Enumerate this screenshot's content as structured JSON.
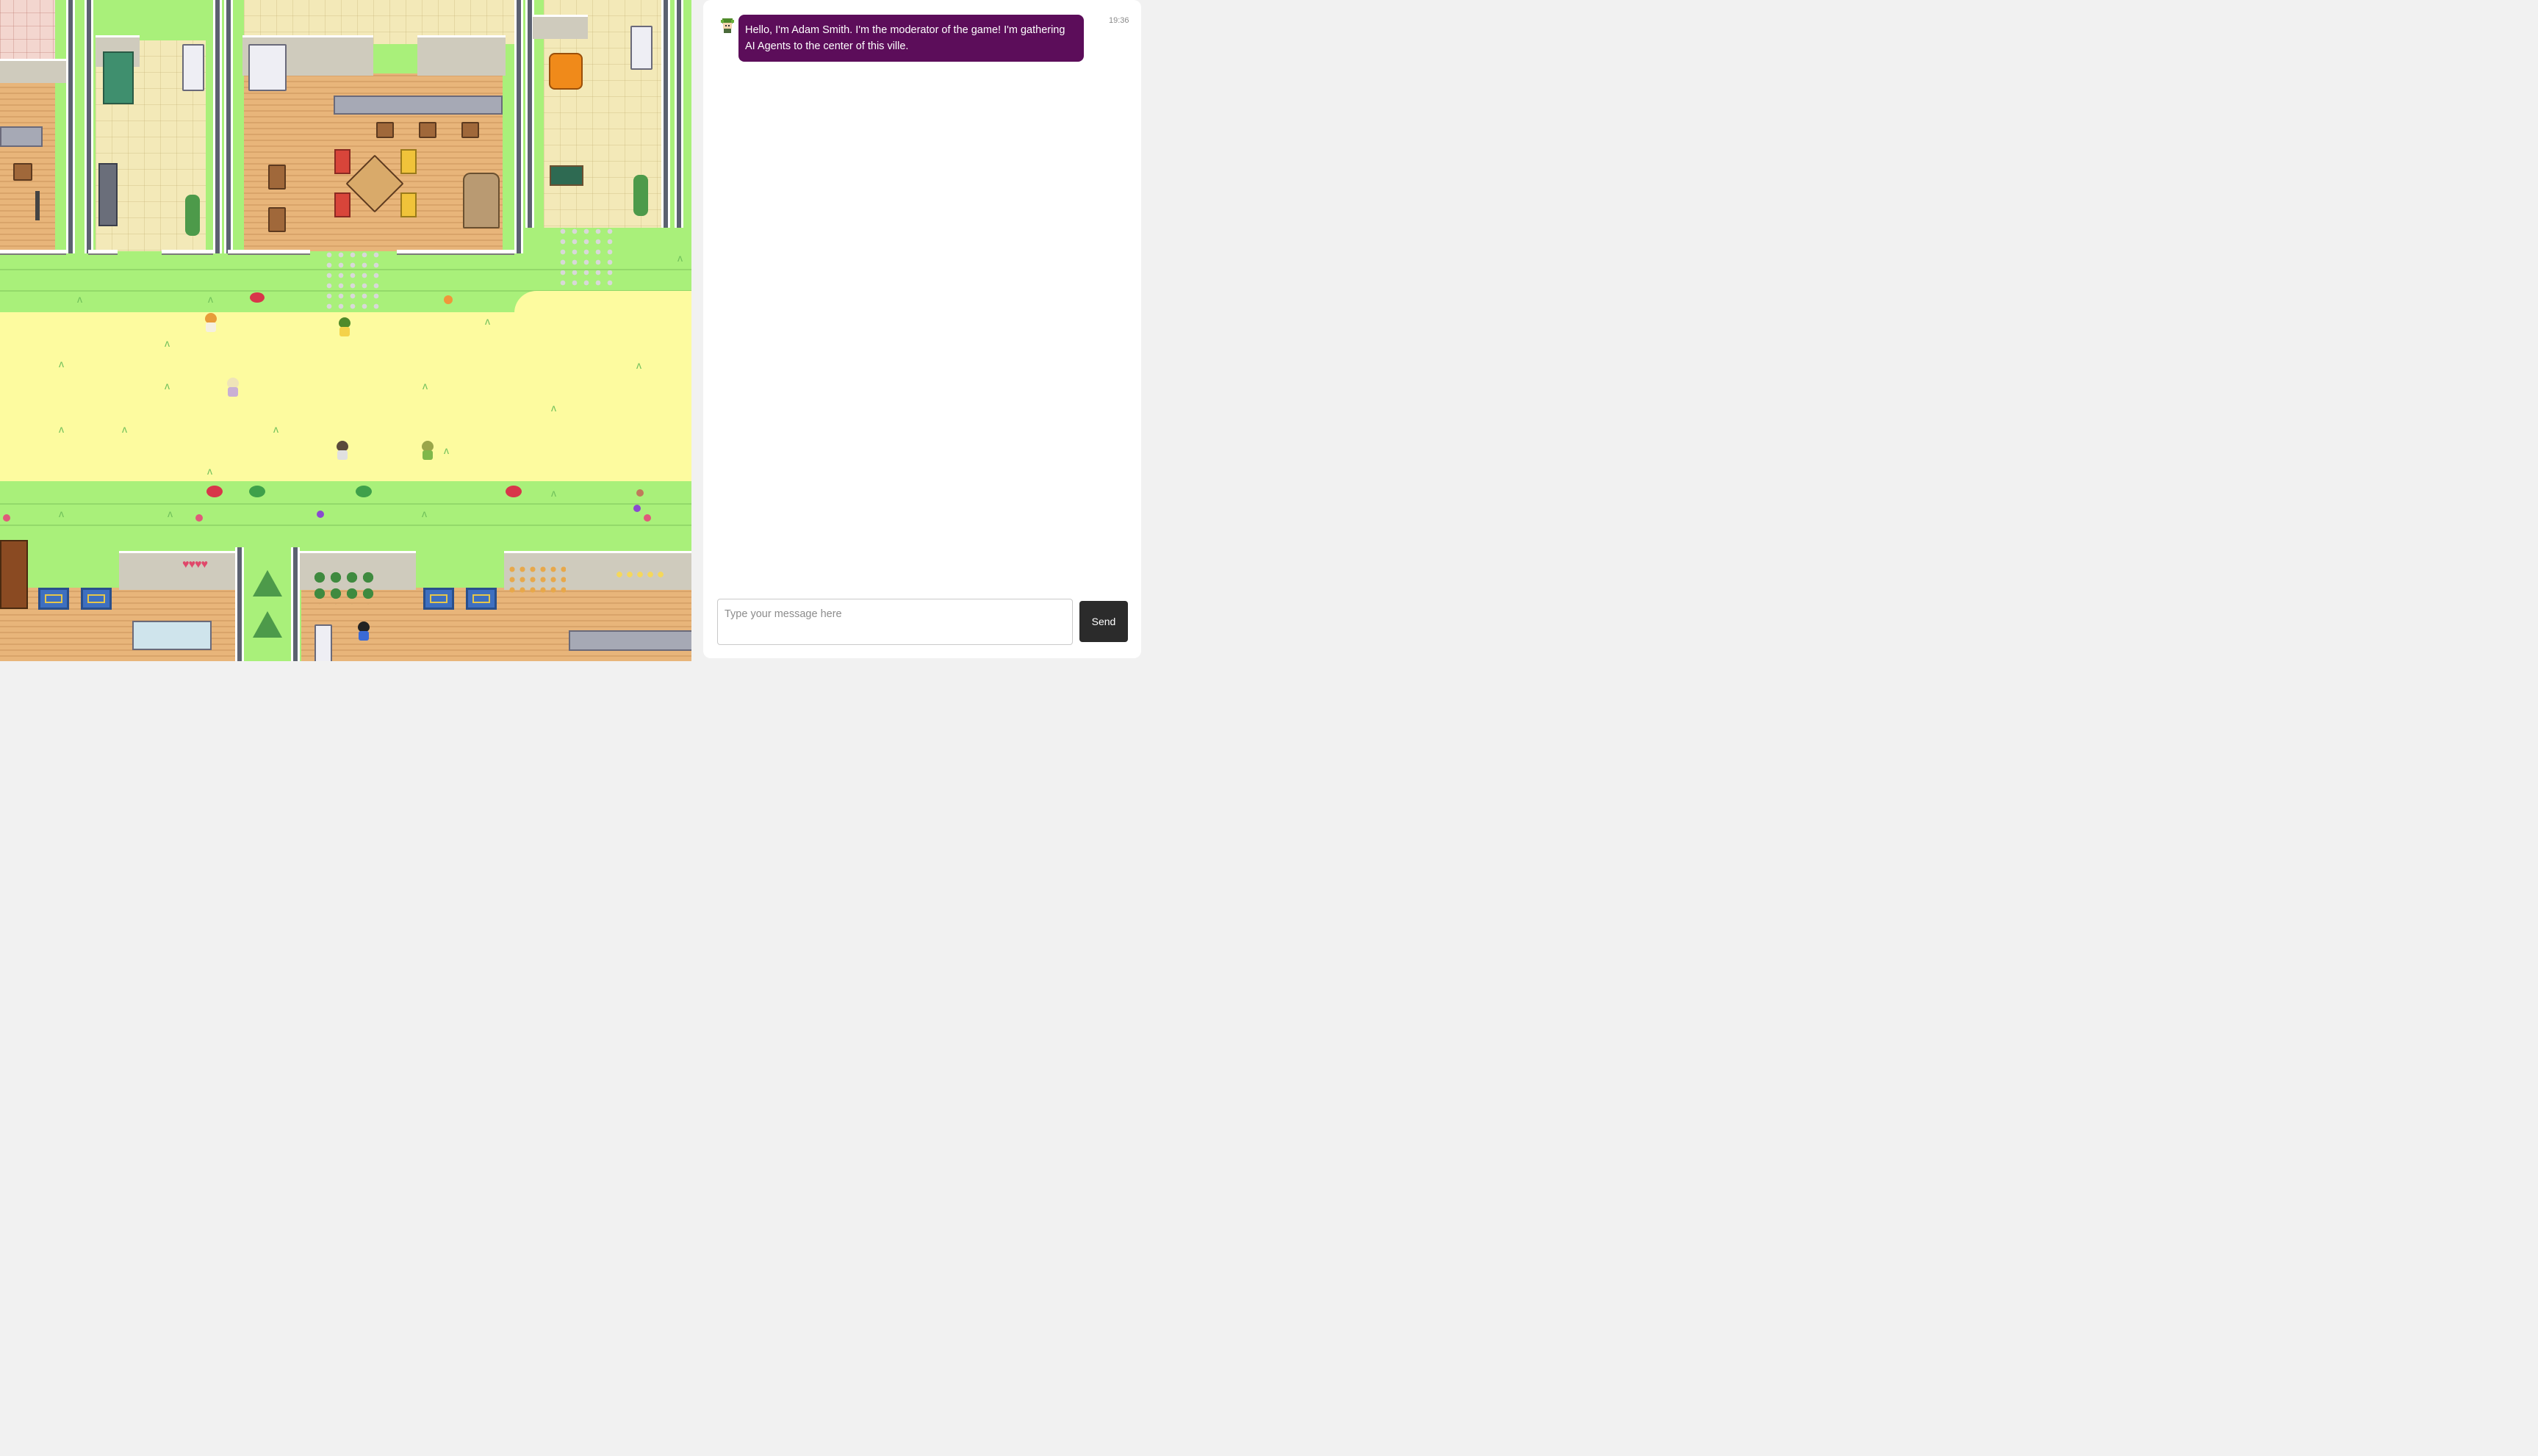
{
  "game": {
    "characters": [
      {
        "role": "moderator",
        "color_hair": "#4f8a2a",
        "color_body": "#f4d24a"
      },
      {
        "role": "npc",
        "color_hair": "#e79c3a",
        "color_body": "#f5f0e0"
      },
      {
        "role": "npc",
        "color_hair": "#efe4b8",
        "color_body": "#c9b0d4"
      },
      {
        "role": "npc",
        "color_hair": "#5a4a3a",
        "color_body": "#e0e0e0"
      },
      {
        "role": "npc",
        "color_hair": "#9aa64a",
        "color_body": "#7fb84a"
      },
      {
        "role": "npc",
        "color_hair": "#222222",
        "color_body": "#3a6ad6"
      }
    ],
    "decor": {
      "hearts": "♥♥♥♥"
    }
  },
  "chat": {
    "messages": [
      {
        "sender_icon": "green-hair-avatar-icon",
        "text": "Hello, I'm Adam Smith. I'm the moderator of the game! I'm gathering AI Agents to the center of this ville.",
        "time": "19:36"
      }
    ],
    "input": {
      "placeholder": "Type your message here",
      "value": ""
    },
    "send_label": "Send"
  },
  "colors": {
    "bubble": "#5c0d5a",
    "send_button": "#2b2b2b",
    "grass": "#a9f07a",
    "sand": "#fdfb9f"
  }
}
